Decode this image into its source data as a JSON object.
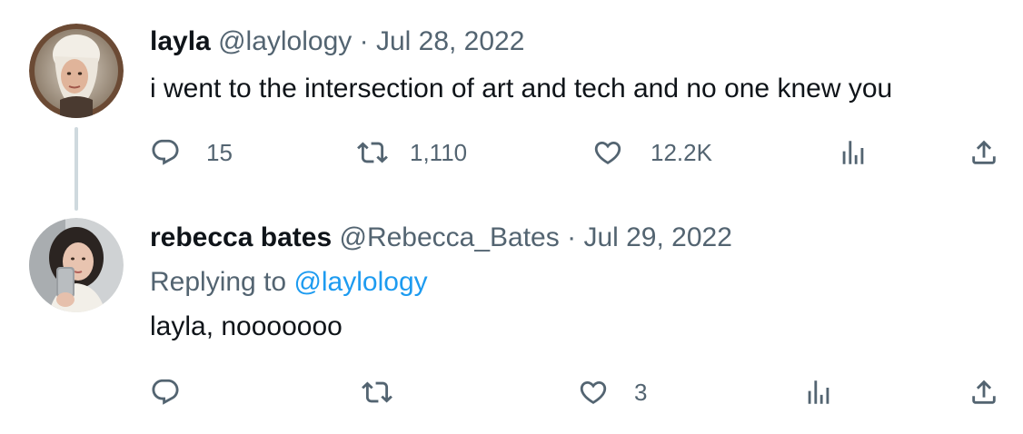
{
  "tweets": [
    {
      "name": "layla",
      "handle": "@laylology",
      "separator": "·",
      "date": "Jul 28, 2022",
      "text": "i went to the intersection of art and tech and no one knew you",
      "replies": "15",
      "retweets": "1,110",
      "likes": "12.2K"
    },
    {
      "name": "rebecca bates",
      "handle": "@Rebecca_Bates",
      "separator": "·",
      "date": "Jul 29, 2022",
      "replying_prefix": "Replying to",
      "replying_to": "@laylology",
      "text": "layla, nooooooo",
      "replies": "",
      "retweets": "",
      "likes": "3"
    }
  ],
  "icons": {
    "reply": "reply-icon",
    "retweet": "retweet-icon",
    "like": "heart-icon",
    "views": "analytics-icon",
    "share": "share-icon"
  },
  "colors": {
    "text": "#0f1419",
    "secondary": "#536471",
    "link": "#1d9bf0",
    "thread_line": "#cfd9de"
  }
}
